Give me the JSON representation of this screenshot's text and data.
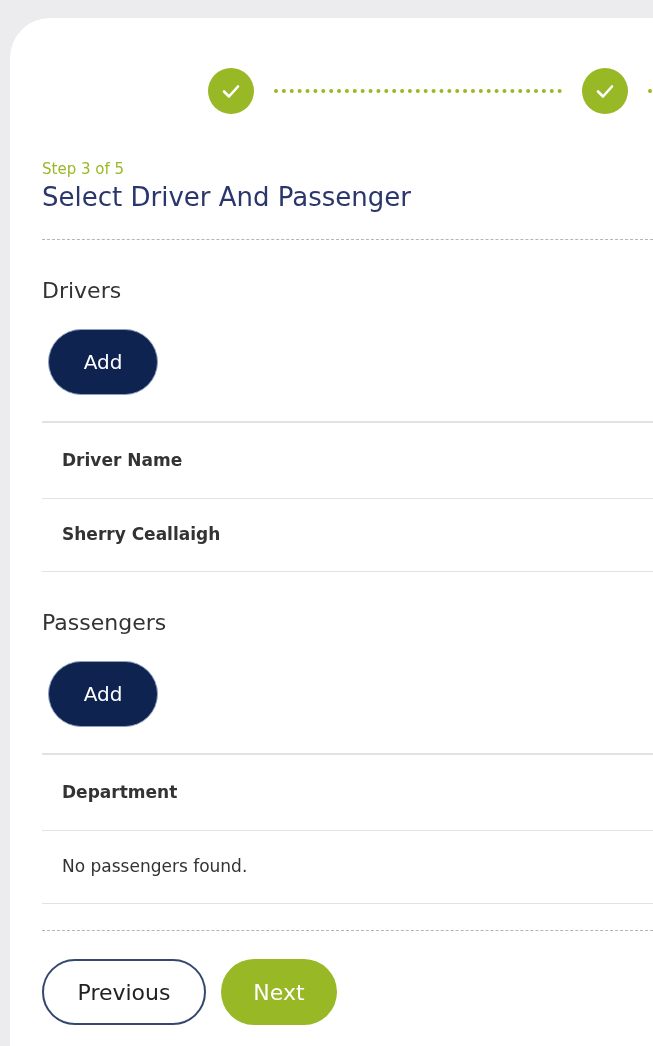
{
  "stepper": {
    "steps": [
      {
        "completed": true
      },
      {
        "completed": true
      }
    ]
  },
  "step_label": "Step 3 of 5",
  "title": "Select Driver And Passenger",
  "sections": [
    {
      "heading": "Drivers",
      "add_button": "Add",
      "table": {
        "columns": [
          "Driver Name"
        ],
        "rows": [
          [
            "Sherry Ceallaigh"
          ]
        ]
      }
    },
    {
      "heading": "Passengers",
      "add_button": "Add",
      "table": {
        "columns": [
          "Department"
        ],
        "empty_message": "No passengers found."
      }
    }
  ],
  "buttons": [
    {
      "label": "Previous",
      "kind": "secondary"
    },
    {
      "label": "Next",
      "kind": "primary"
    }
  ]
}
